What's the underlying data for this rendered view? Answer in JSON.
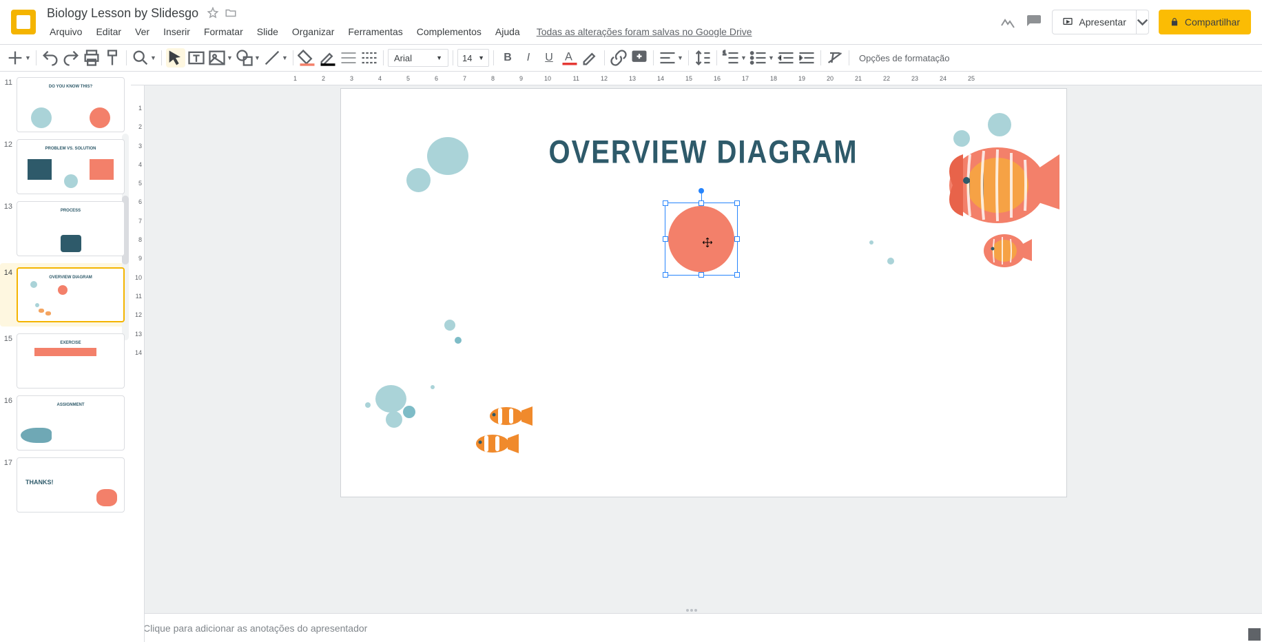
{
  "header": {
    "doc_title": "Biology Lesson by Slidesgo",
    "menus": [
      "Arquivo",
      "Editar",
      "Ver",
      "Inserir",
      "Formatar",
      "Slide",
      "Organizar",
      "Ferramentas",
      "Complementos",
      "Ajuda"
    ],
    "saved_text": "Todas as alterações foram salvas no Google Drive",
    "present_label": "Apresentar",
    "share_label": "Compartilhar"
  },
  "toolbar": {
    "font_name": "Arial",
    "font_size": "14",
    "format_options": "Opções de formatação"
  },
  "filmstrip": {
    "slides": [
      {
        "n": "11",
        "label": "DO YOU KNOW THIS?"
      },
      {
        "n": "12",
        "label": "PROBLEM VS. SOLUTION"
      },
      {
        "n": "13",
        "label": "PROCESS"
      },
      {
        "n": "14",
        "label": "OVERVIEW DIAGRAM",
        "selected": true
      },
      {
        "n": "15",
        "label": "EXERCISE"
      },
      {
        "n": "16",
        "label": "ASSIGNMENT"
      },
      {
        "n": "17",
        "label": "THANKS!"
      }
    ]
  },
  "slide": {
    "title": "OVERVIEW DIAGRAM"
  },
  "ruler_h": [
    "1",
    "2",
    "3",
    "4",
    "5",
    "6",
    "7",
    "8",
    "9",
    "10",
    "11",
    "12",
    "13",
    "14",
    "15",
    "16",
    "17",
    "18",
    "19",
    "20",
    "21",
    "22",
    "23",
    "24",
    "25"
  ],
  "ruler_v": [
    "1",
    "2",
    "3",
    "4",
    "5",
    "6",
    "7",
    "8",
    "9",
    "10",
    "11",
    "12",
    "13",
    "14"
  ],
  "notes": {
    "placeholder": "Clique para adicionar as anotações do apresentador"
  },
  "colors": {
    "accent_title": "#2e5a6a",
    "shape_fill": "#f3806a",
    "selection": "#2684fc",
    "brand_yellow": "#fbbc04"
  }
}
